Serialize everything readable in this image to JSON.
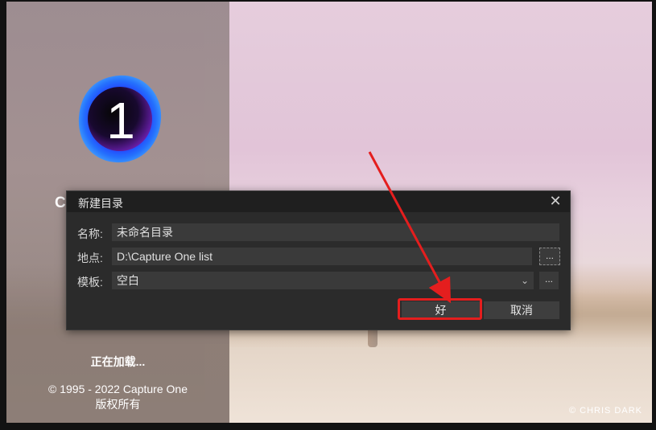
{
  "splash": {
    "partial_title": "C",
    "loading_text": "正在加载...",
    "copyright_line1": "© 1995 - 2022 Capture One",
    "copyright_line2": "版权所有",
    "photo_credit": "© CHRIS DARK",
    "logo_digit": "1"
  },
  "dialog": {
    "title": "新建目录",
    "close_glyph": "✕",
    "name_label": "名称:",
    "name_value": "未命名目录",
    "location_label": "地点:",
    "location_value": "D:\\Capture One list",
    "location_browse": "...",
    "template_label": "模板:",
    "template_value": "空白",
    "template_more": "...",
    "ok_label": "好",
    "cancel_label": "取消"
  },
  "colors": {
    "annotation_red": "#e41e1e",
    "dialog_bg": "#2b2b2b"
  }
}
